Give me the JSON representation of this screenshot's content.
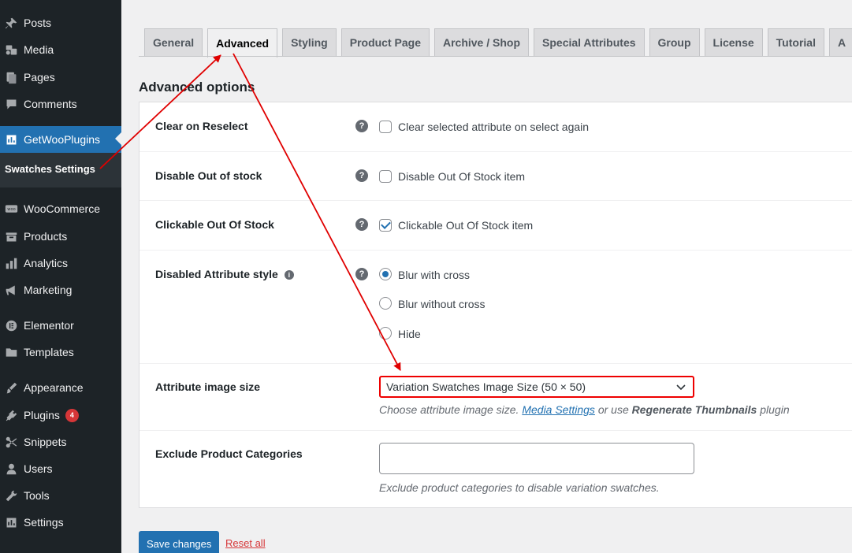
{
  "sidebar": {
    "items": [
      {
        "label": "Posts",
        "icon": "pushpin-icon"
      },
      {
        "label": "Media",
        "icon": "media-icon"
      },
      {
        "label": "Pages",
        "icon": "pages-icon"
      },
      {
        "label": "Comments",
        "icon": "comments-icon"
      },
      {
        "label": "GetWooPlugins",
        "icon": "getwooplugins-icon",
        "active": true
      },
      {
        "label": "WooCommerce",
        "icon": "woocommerce-icon"
      },
      {
        "label": "Products",
        "icon": "products-icon"
      },
      {
        "label": "Analytics",
        "icon": "analytics-icon"
      },
      {
        "label": "Marketing",
        "icon": "megaphone-icon"
      },
      {
        "label": "Elementor",
        "icon": "elementor-icon"
      },
      {
        "label": "Templates",
        "icon": "folder-icon"
      },
      {
        "label": "Appearance",
        "icon": "brush-icon"
      },
      {
        "label": "Plugins",
        "icon": "plugin-icon",
        "badge": "4"
      },
      {
        "label": "Snippets",
        "icon": "scissors-icon"
      },
      {
        "label": "Users",
        "icon": "user-icon"
      },
      {
        "label": "Tools",
        "icon": "wrench-icon"
      },
      {
        "label": "Settings",
        "icon": "settings-icon"
      }
    ],
    "submenu": {
      "label": "Swatches Settings"
    }
  },
  "tabs": [
    {
      "label": "General"
    },
    {
      "label": "Advanced",
      "active": true
    },
    {
      "label": "Styling"
    },
    {
      "label": "Product Page"
    },
    {
      "label": "Archive / Shop"
    },
    {
      "label": "Special Attributes"
    },
    {
      "label": "Group"
    },
    {
      "label": "License"
    },
    {
      "label": "Tutorial"
    },
    {
      "label": "A"
    }
  ],
  "section_title": "Advanced options",
  "settings": {
    "clear_on_reselect": {
      "label": "Clear on Reselect",
      "option": "Clear selected attribute on select again",
      "checked": false
    },
    "disable_out_of_stock": {
      "label": "Disable Out of stock",
      "option": "Disable Out Of Stock item",
      "checked": false
    },
    "clickable_out_of_stock": {
      "label": "Clickable Out Of Stock",
      "option": "Clickable Out Of Stock item",
      "checked": true
    },
    "disabled_attribute_style": {
      "label": "Disabled Attribute style",
      "options": [
        "Blur with cross",
        "Blur without cross",
        "Hide"
      ],
      "selected": "Blur with cross"
    },
    "attribute_image_size": {
      "label": "Attribute image size",
      "value": "Variation Swatches Image Size (50 × 50)",
      "desc_prefix": "Choose attribute image size.",
      "desc_link": "Media Settings",
      "desc_middle": "or use",
      "desc_bold": "Regenerate Thumbnails",
      "desc_suffix": "plugin"
    },
    "exclude_product_categories": {
      "label": "Exclude Product Categories",
      "value": "",
      "desc": "Exclude product categories to disable variation swatches."
    }
  },
  "actions": {
    "save_label": "Save changes",
    "reset_label": "Reset all"
  },
  "colors": {
    "accent": "#2271b1",
    "sidebar_bg": "#1d2327",
    "annotation": "#e00000",
    "badge": "#d63638"
  }
}
